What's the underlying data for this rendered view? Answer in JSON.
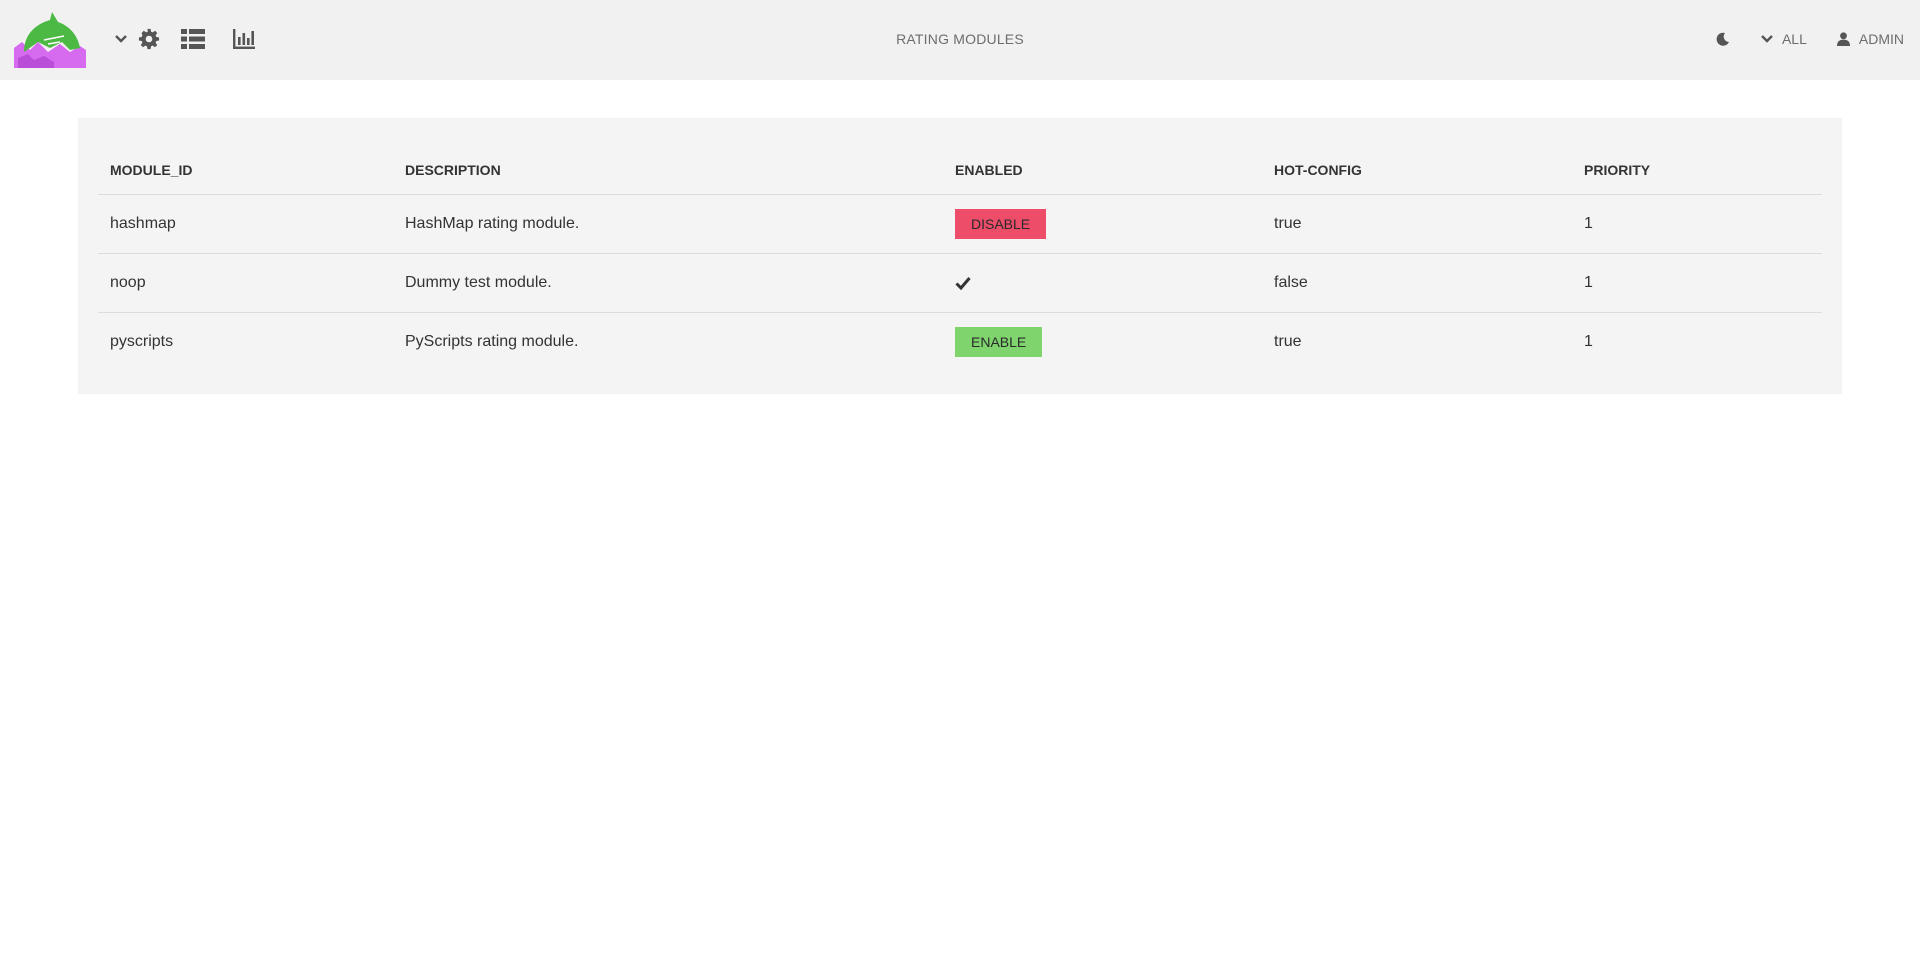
{
  "header": {
    "title": "RATING MODULES",
    "nav_icons": [
      "chevron-down-icon",
      "gear-icon",
      "table-list-icon",
      "bar-chart-icon"
    ],
    "theme_icon": "moon-icon",
    "scope_label": "ALL",
    "user_label": "ADMIN"
  },
  "table": {
    "columns": [
      "MODULE_ID",
      "DESCRIPTION",
      "ENABLED",
      "HOT-CONFIG",
      "PRIORITY"
    ],
    "rows": [
      {
        "module_id": "hashmap",
        "description": "HashMap rating module.",
        "enabled_action": "DISABLE",
        "hot_config": "true",
        "priority": "1"
      },
      {
        "module_id": "noop",
        "description": "Dummy test module.",
        "enabled_icon": "check-icon",
        "hot_config": "false",
        "priority": "1"
      },
      {
        "module_id": "pyscripts",
        "description": "PyScripts rating module.",
        "enabled_action": "ENABLE",
        "hot_config": "true",
        "priority": "1"
      }
    ]
  },
  "colors": {
    "topbar_bg": "#f1f1f1",
    "panel_bg": "#f4f4f4",
    "disable_button": "#ee4d6a",
    "enable_button": "#7fd46e",
    "logo_green": "#4cb944",
    "logo_purple": "#d66bf0"
  }
}
